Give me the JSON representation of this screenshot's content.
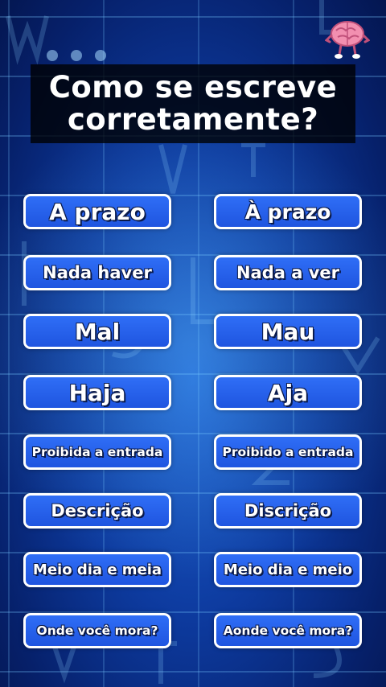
{
  "title": {
    "line1": "Como se escreve",
    "line2": "corretamente?"
  },
  "options": [
    {
      "left": "A prazo",
      "right": "À prazo"
    },
    {
      "left": "Nada haver",
      "right": "Nada a ver"
    },
    {
      "left": "Mal",
      "right": "Mau"
    },
    {
      "left": "Haja",
      "right": "Aja"
    },
    {
      "left": "Proibida a entrada",
      "right": "Proibido a entrada"
    },
    {
      "left": "Descrição",
      "right": "Discrição"
    },
    {
      "left": "Meio dia e meia",
      "right": "Meio dia e meio"
    },
    {
      "left": "Onde você mora?",
      "right": "Aonde você mora?"
    }
  ],
  "icons": {
    "brain": "brain-mascot-icon"
  },
  "colors": {
    "button_fill": "#2f6ef6",
    "button_border": "#ffffff",
    "title_bg": "#000000",
    "background": "#0d3a9e"
  }
}
